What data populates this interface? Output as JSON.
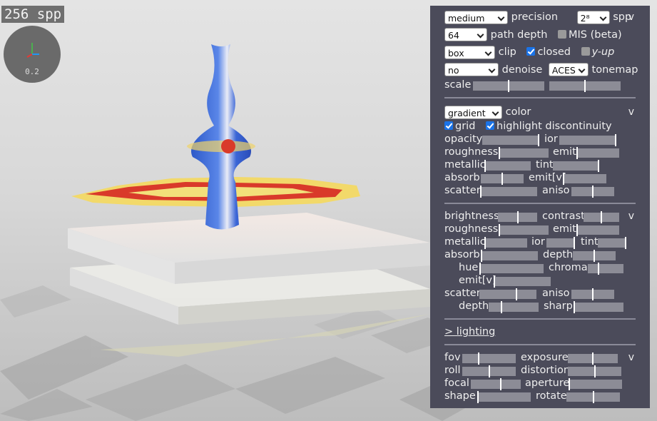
{
  "overlay": {
    "spp": "256 spp",
    "gizmo_value": "0.2"
  },
  "render": {
    "precision": {
      "value": "medium",
      "label": "precision"
    },
    "spp": {
      "value": "2⁸",
      "label": "spp"
    },
    "path_depth": {
      "value": "64",
      "label": "path depth"
    },
    "mis": {
      "label": "MIS (beta)",
      "checked": false
    },
    "clip": {
      "value": "box",
      "label": "clip"
    },
    "closed": {
      "label": "closed",
      "checked": true
    },
    "yup": {
      "label": "y-up",
      "checked": false
    },
    "denoise": {
      "value": "no",
      "label": "denoise"
    },
    "tonemap": {
      "value": "ACES",
      "label": "tonemap"
    },
    "scale": {
      "label": "scale",
      "values": [
        0.5,
        0.5
      ]
    },
    "collapse": "v"
  },
  "material": {
    "color": {
      "value": "gradient",
      "label": "color"
    },
    "grid": {
      "label": "grid",
      "checked": true
    },
    "highlight": {
      "label": "highlight discontinuity",
      "checked": true
    },
    "collapse": "v",
    "rows": [
      {
        "a": {
          "label": "opacity",
          "v": 1.0
        },
        "b": {
          "label": "ior",
          "v": 1.0
        }
      },
      {
        "a": {
          "label": "roughness",
          "v": 0.0
        },
        "b": {
          "label": "emit",
          "v": 0.0
        }
      },
      {
        "a": {
          "label": "metallic",
          "v": 0.0
        },
        "b": {
          "label": "tint",
          "v": 1.0
        }
      },
      {
        "a": {
          "label": "absorb",
          "v": 0.5
        },
        "b": {
          "label": "emit[v]",
          "v": 0.0
        }
      },
      {
        "a": {
          "label": "scatter",
          "v": 0.0
        },
        "b": {
          "label": "aniso",
          "v": 0.5
        }
      }
    ]
  },
  "volume": {
    "collapse": "v",
    "brightness": {
      "label": "brightness",
      "v": 0.5
    },
    "contrast": {
      "label": "contrast",
      "v": 0.5
    },
    "roughness": {
      "label": "roughness",
      "v": 0.0
    },
    "emit": {
      "label": "emit",
      "v": 0.0
    },
    "metallic": {
      "label": "metallic",
      "v": 0.0
    },
    "ior": {
      "label": "ior",
      "v": 1.0
    },
    "tint": {
      "label": "tint",
      "v": 1.0
    },
    "absorb": {
      "label": "absorb",
      "v": 0.0
    },
    "depth": {
      "label": "depth",
      "v": 0.5
    },
    "hue": {
      "label": "hue",
      "v": 0.0
    },
    "chroma": {
      "label": "chroma",
      "v": 0.3
    },
    "emitv": {
      "label": "emit[v]",
      "v": 0.0
    },
    "scatter": {
      "label": "scatter",
      "v": 0.65
    },
    "aniso": {
      "label": "aniso",
      "v": 0.5
    },
    "vdepth": {
      "label": "depth",
      "v": 0.25
    },
    "sharp": {
      "label": "sharp",
      "v": 0.0
    }
  },
  "lighting": {
    "label": "> lighting"
  },
  "camera": {
    "collapse": "v",
    "fov": {
      "label": "fov",
      "v": 0.3
    },
    "exposure": {
      "label": "exposure",
      "v": 0.5
    },
    "roll": {
      "label": "roll",
      "v": 0.5
    },
    "distortion": {
      "label": "distortion",
      "v": 0.5
    },
    "focal": {
      "label": "focal",
      "v": 0.6
    },
    "aperture": {
      "label": "aperture",
      "v": 0.0
    },
    "shape": {
      "label": "shape",
      "v": 0.0
    },
    "rotate": {
      "label": "rotate",
      "v": 0.5
    }
  }
}
